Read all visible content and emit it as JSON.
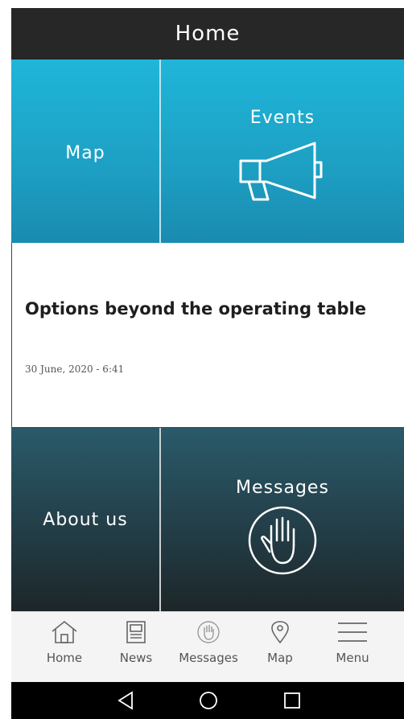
{
  "header": {
    "title": "Home"
  },
  "tiles": {
    "map": {
      "label": "Map"
    },
    "events": {
      "label": "Events",
      "icon": "megaphone-icon"
    },
    "about": {
      "label": "About us"
    },
    "messages": {
      "label": "Messages",
      "icon": "hand-icon"
    }
  },
  "article": {
    "title": "Options beyond the operating table",
    "date": "30 June, 2020 - 6:41"
  },
  "tabbar": {
    "items": [
      {
        "label": "Home",
        "icon": "home-icon"
      },
      {
        "label": "News",
        "icon": "news-icon"
      },
      {
        "label": "Messages",
        "icon": "hand-icon"
      },
      {
        "label": "Map",
        "icon": "map-pin-icon"
      },
      {
        "label": "Menu",
        "icon": "hamburger-icon"
      }
    ]
  },
  "colors": {
    "header": "#272727",
    "tile_top": "#1fb6d9",
    "tile_bottom": "#233e48",
    "tabbar": "#f4f4f4"
  }
}
